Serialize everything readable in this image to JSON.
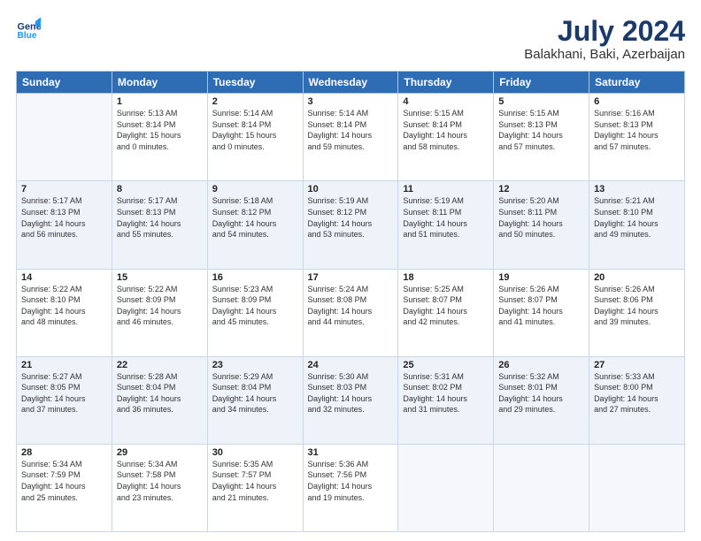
{
  "header": {
    "logo_line1": "General",
    "logo_line2": "Blue",
    "main_title": "July 2024",
    "subtitle": "Balakhani, Baki, Azerbaijan"
  },
  "weekdays": [
    "Sunday",
    "Monday",
    "Tuesday",
    "Wednesday",
    "Thursday",
    "Friday",
    "Saturday"
  ],
  "weeks": [
    [
      {
        "day": "",
        "info": ""
      },
      {
        "day": "1",
        "info": "Sunrise: 5:13 AM\nSunset: 8:14 PM\nDaylight: 15 hours\nand 0 minutes."
      },
      {
        "day": "2",
        "info": "Sunrise: 5:14 AM\nSunset: 8:14 PM\nDaylight: 15 hours\nand 0 minutes."
      },
      {
        "day": "3",
        "info": "Sunrise: 5:14 AM\nSunset: 8:14 PM\nDaylight: 14 hours\nand 59 minutes."
      },
      {
        "day": "4",
        "info": "Sunrise: 5:15 AM\nSunset: 8:14 PM\nDaylight: 14 hours\nand 58 minutes."
      },
      {
        "day": "5",
        "info": "Sunrise: 5:15 AM\nSunset: 8:13 PM\nDaylight: 14 hours\nand 57 minutes."
      },
      {
        "day": "6",
        "info": "Sunrise: 5:16 AM\nSunset: 8:13 PM\nDaylight: 14 hours\nand 57 minutes."
      }
    ],
    [
      {
        "day": "7",
        "info": "Sunrise: 5:17 AM\nSunset: 8:13 PM\nDaylight: 14 hours\nand 56 minutes."
      },
      {
        "day": "8",
        "info": "Sunrise: 5:17 AM\nSunset: 8:13 PM\nDaylight: 14 hours\nand 55 minutes."
      },
      {
        "day": "9",
        "info": "Sunrise: 5:18 AM\nSunset: 8:12 PM\nDaylight: 14 hours\nand 54 minutes."
      },
      {
        "day": "10",
        "info": "Sunrise: 5:19 AM\nSunset: 8:12 PM\nDaylight: 14 hours\nand 53 minutes."
      },
      {
        "day": "11",
        "info": "Sunrise: 5:19 AM\nSunset: 8:11 PM\nDaylight: 14 hours\nand 51 minutes."
      },
      {
        "day": "12",
        "info": "Sunrise: 5:20 AM\nSunset: 8:11 PM\nDaylight: 14 hours\nand 50 minutes."
      },
      {
        "day": "13",
        "info": "Sunrise: 5:21 AM\nSunset: 8:10 PM\nDaylight: 14 hours\nand 49 minutes."
      }
    ],
    [
      {
        "day": "14",
        "info": "Sunrise: 5:22 AM\nSunset: 8:10 PM\nDaylight: 14 hours\nand 48 minutes."
      },
      {
        "day": "15",
        "info": "Sunrise: 5:22 AM\nSunset: 8:09 PM\nDaylight: 14 hours\nand 46 minutes."
      },
      {
        "day": "16",
        "info": "Sunrise: 5:23 AM\nSunset: 8:09 PM\nDaylight: 14 hours\nand 45 minutes."
      },
      {
        "day": "17",
        "info": "Sunrise: 5:24 AM\nSunset: 8:08 PM\nDaylight: 14 hours\nand 44 minutes."
      },
      {
        "day": "18",
        "info": "Sunrise: 5:25 AM\nSunset: 8:07 PM\nDaylight: 14 hours\nand 42 minutes."
      },
      {
        "day": "19",
        "info": "Sunrise: 5:26 AM\nSunset: 8:07 PM\nDaylight: 14 hours\nand 41 minutes."
      },
      {
        "day": "20",
        "info": "Sunrise: 5:26 AM\nSunset: 8:06 PM\nDaylight: 14 hours\nand 39 minutes."
      }
    ],
    [
      {
        "day": "21",
        "info": "Sunrise: 5:27 AM\nSunset: 8:05 PM\nDaylight: 14 hours\nand 37 minutes."
      },
      {
        "day": "22",
        "info": "Sunrise: 5:28 AM\nSunset: 8:04 PM\nDaylight: 14 hours\nand 36 minutes."
      },
      {
        "day": "23",
        "info": "Sunrise: 5:29 AM\nSunset: 8:04 PM\nDaylight: 14 hours\nand 34 minutes."
      },
      {
        "day": "24",
        "info": "Sunrise: 5:30 AM\nSunset: 8:03 PM\nDaylight: 14 hours\nand 32 minutes."
      },
      {
        "day": "25",
        "info": "Sunrise: 5:31 AM\nSunset: 8:02 PM\nDaylight: 14 hours\nand 31 minutes."
      },
      {
        "day": "26",
        "info": "Sunrise: 5:32 AM\nSunset: 8:01 PM\nDaylight: 14 hours\nand 29 minutes."
      },
      {
        "day": "27",
        "info": "Sunrise: 5:33 AM\nSunset: 8:00 PM\nDaylight: 14 hours\nand 27 minutes."
      }
    ],
    [
      {
        "day": "28",
        "info": "Sunrise: 5:34 AM\nSunset: 7:59 PM\nDaylight: 14 hours\nand 25 minutes."
      },
      {
        "day": "29",
        "info": "Sunrise: 5:34 AM\nSunset: 7:58 PM\nDaylight: 14 hours\nand 23 minutes."
      },
      {
        "day": "30",
        "info": "Sunrise: 5:35 AM\nSunset: 7:57 PM\nDaylight: 14 hours\nand 21 minutes."
      },
      {
        "day": "31",
        "info": "Sunrise: 5:36 AM\nSunset: 7:56 PM\nDaylight: 14 hours\nand 19 minutes."
      },
      {
        "day": "",
        "info": ""
      },
      {
        "day": "",
        "info": ""
      },
      {
        "day": "",
        "info": ""
      }
    ]
  ]
}
